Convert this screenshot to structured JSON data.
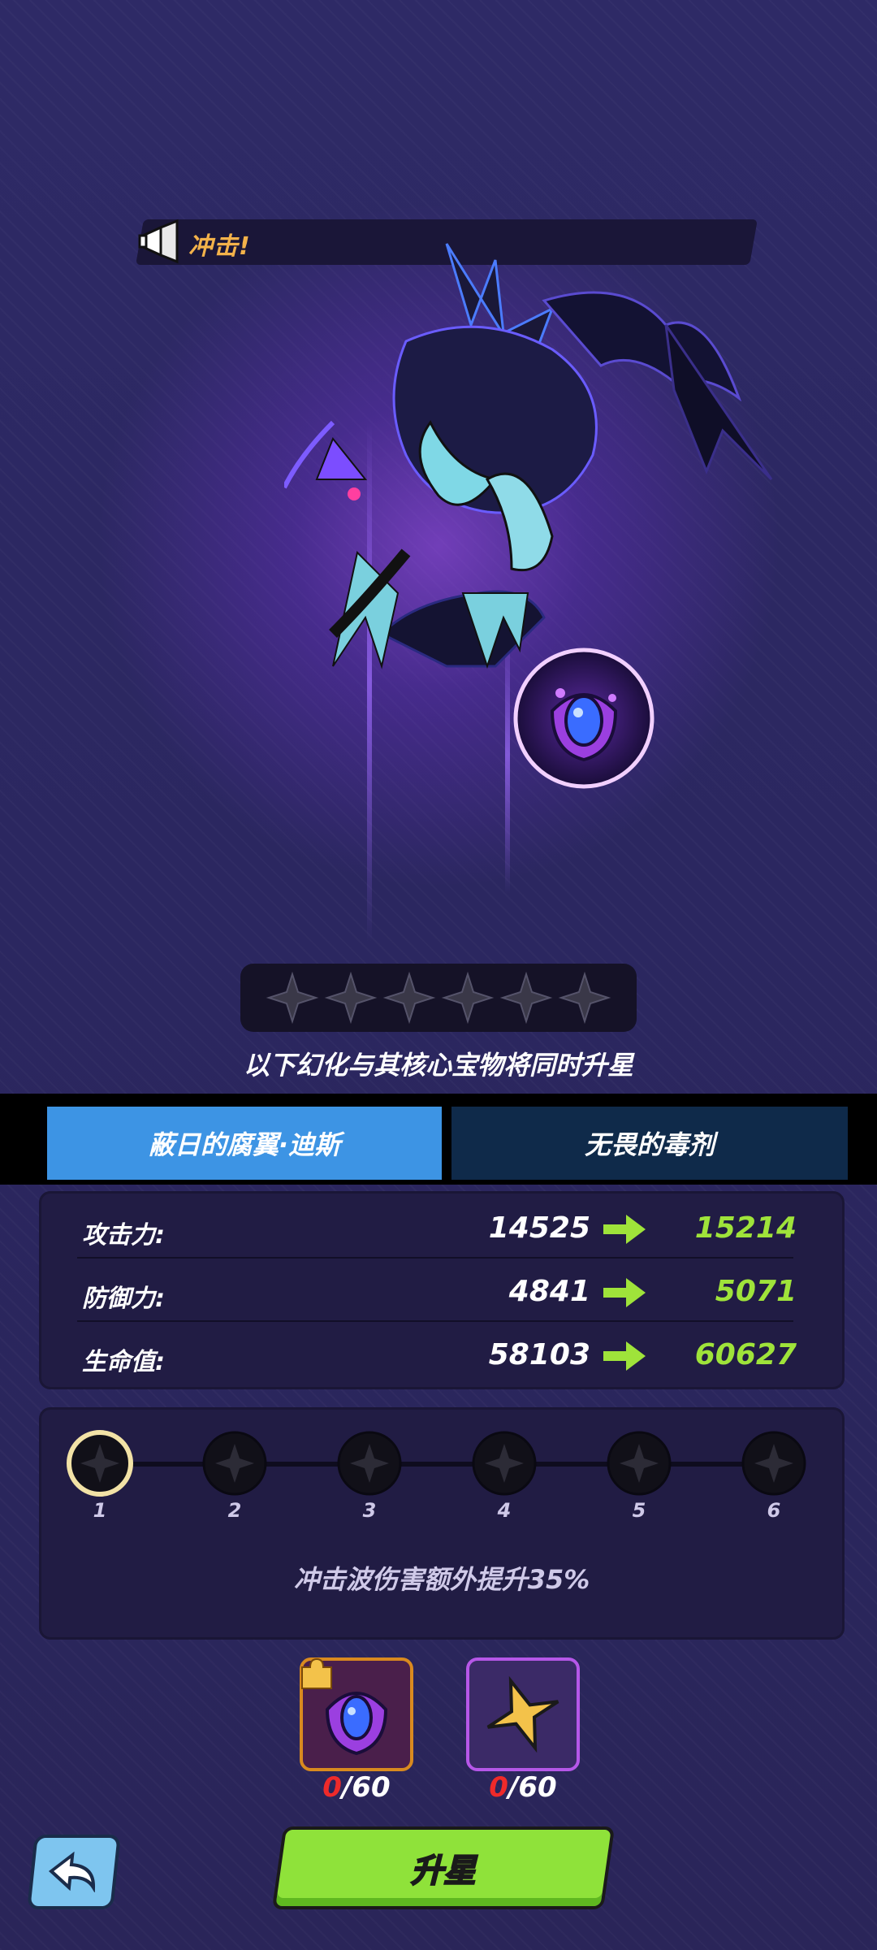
{
  "ability": {
    "name": "冲击!"
  },
  "stars": {
    "count": 6,
    "filled": 0
  },
  "subtitle": "以下幻化与其核心宝物将同时升星",
  "tabs": [
    {
      "label": "蔽日的腐翼·迪斯",
      "active": true
    },
    {
      "label": "无畏的毒剂",
      "active": false
    }
  ],
  "stats": [
    {
      "label": "攻击力:",
      "old": "14525",
      "new": "15214"
    },
    {
      "label": "防御力:",
      "old": "4841",
      "new": "5071"
    },
    {
      "label": "生命值:",
      "old": "58103",
      "new": "60627"
    }
  ],
  "star_progress": {
    "nodes": [
      "1",
      "2",
      "3",
      "4",
      "5",
      "6"
    ],
    "selected": 1,
    "description": "冲击波伤害额外提升35%"
  },
  "materials": [
    {
      "icon": "purple-eye-gem-icon",
      "current": "0",
      "required": "/60"
    },
    {
      "icon": "gold-star-icon",
      "current": "0",
      "required": "/60"
    }
  ],
  "buttons": {
    "upgrade": "升星",
    "back_icon": "back-arrow-icon"
  },
  "colors": {
    "accent_green": "#9fe33a",
    "tab_active": "#3d94e4",
    "tab_inactive": "#0f2a4a",
    "count_red": "#ef2a2a"
  }
}
